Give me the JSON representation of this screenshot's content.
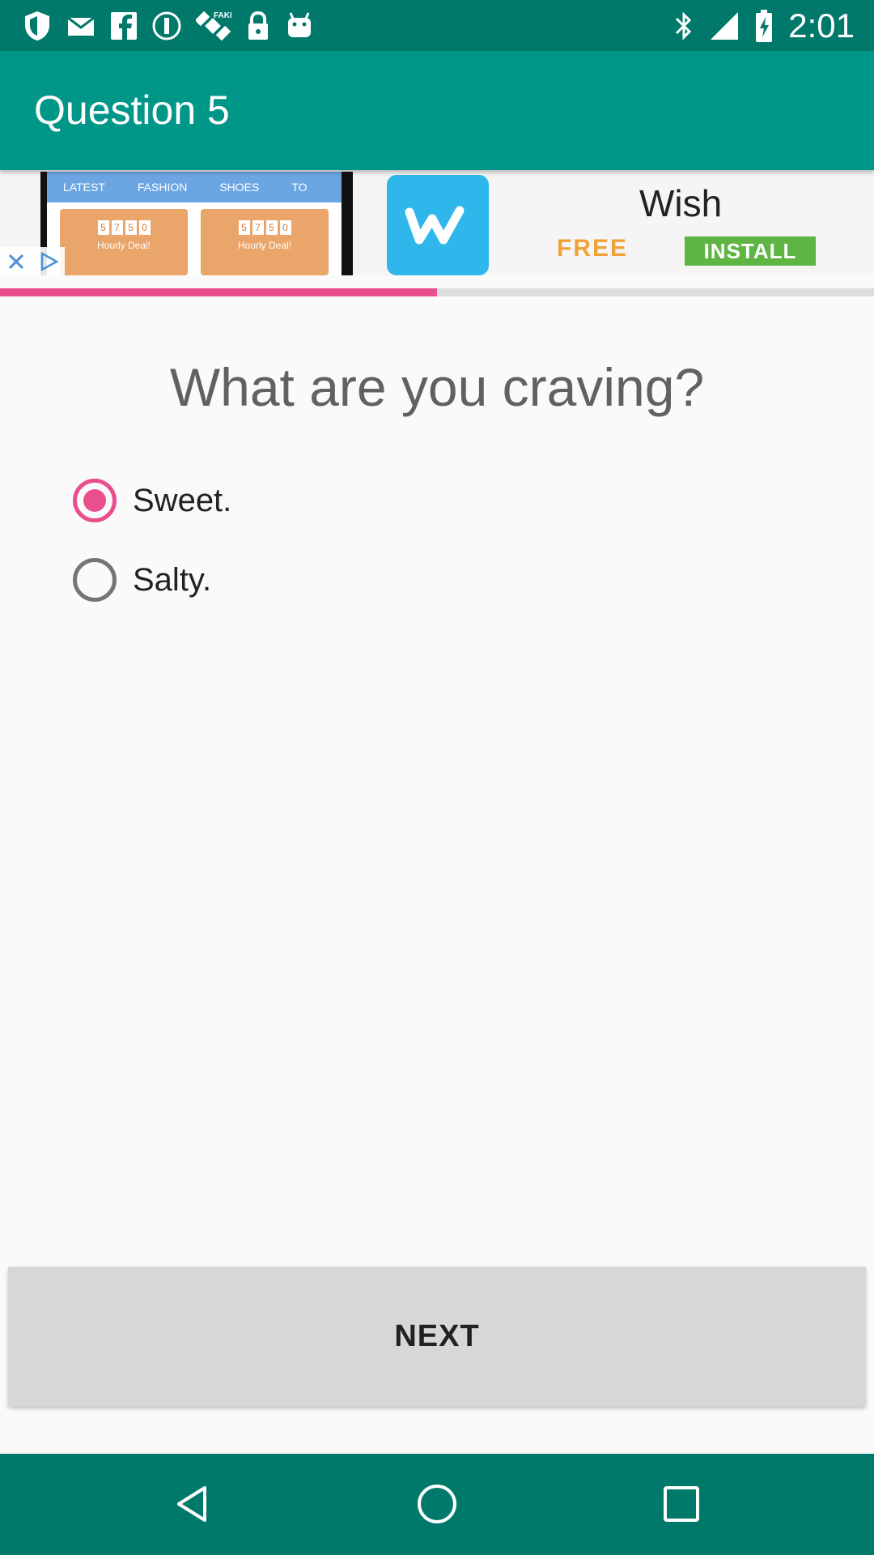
{
  "status_bar": {
    "time": "2:01",
    "left_icons": [
      "shield-icon",
      "mail-icon",
      "facebook-icon",
      "info-circle-icon",
      "satellite-icon",
      "lock-icon",
      "android-icon"
    ],
    "right_icons": [
      "bluetooth-icon",
      "signal-icon",
      "battery-icon"
    ]
  },
  "app_bar": {
    "title": "Question 5"
  },
  "ad": {
    "tabs": [
      "LATEST",
      "FASHION",
      "SHOES",
      "TO"
    ],
    "deal_digits": [
      "5",
      "7",
      "5",
      "0"
    ],
    "deal_label": "Hourly Deal!",
    "brand": "Wish",
    "free_label": "FREE",
    "install_label": "INSTALL"
  },
  "progress": {
    "fraction": 0.5,
    "color": "#e84f8c"
  },
  "question": {
    "text": "What are you craving?",
    "options": [
      {
        "label": "Sweet.",
        "selected": true
      },
      {
        "label": "Salty.",
        "selected": false
      }
    ]
  },
  "actions": {
    "next_label": "NEXT"
  },
  "nav_bar": {
    "icons": [
      "back-icon",
      "home-icon",
      "recents-icon"
    ]
  },
  "colors": {
    "status_bar": "#00796b",
    "app_bar": "#009688",
    "accent": "#e84f8c"
  }
}
